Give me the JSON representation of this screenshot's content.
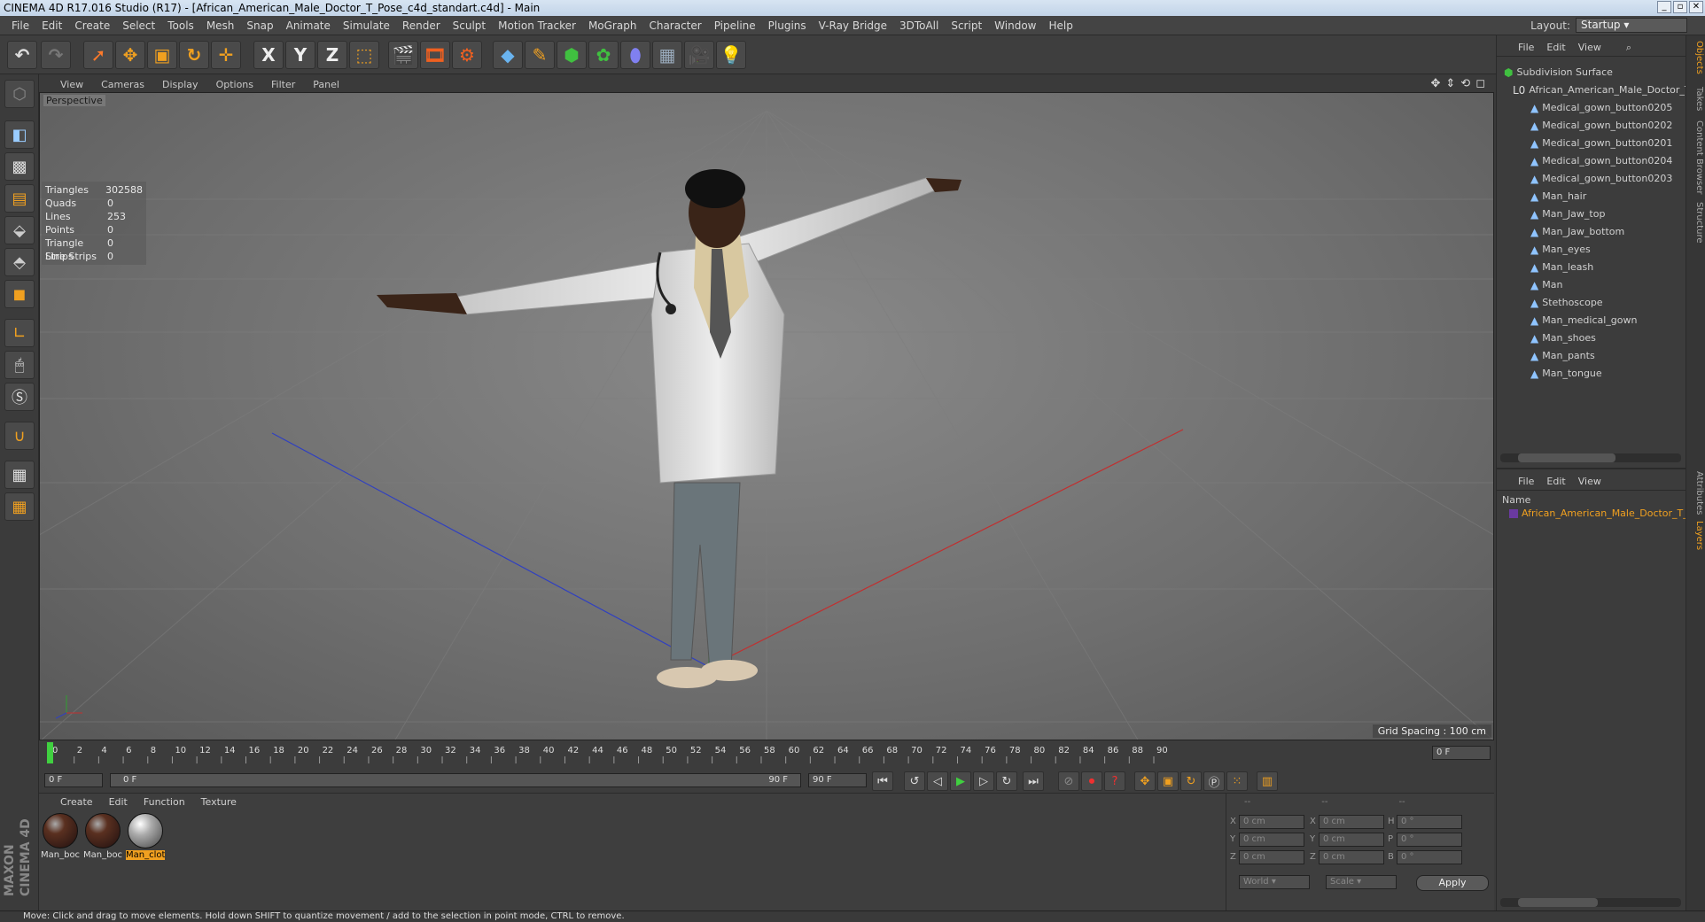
{
  "window": {
    "title": "CINEMA 4D R17.016 Studio (R17) - [African_American_Male_Doctor_T_Pose_c4d_standart.c4d] - Main"
  },
  "menu": [
    "File",
    "Edit",
    "Create",
    "Select",
    "Tools",
    "Mesh",
    "Snap",
    "Animate",
    "Simulate",
    "Render",
    "Sculpt",
    "Motion Tracker",
    "MoGraph",
    "Character",
    "Pipeline",
    "Plugins",
    "V-Ray Bridge",
    "3DToAll",
    "Script",
    "Window",
    "Help"
  ],
  "layout": {
    "label": "Layout:",
    "value": "Startup"
  },
  "toolbar_axes": [
    "X",
    "Y",
    "Z"
  ],
  "viewport": {
    "menu": [
      "View",
      "Cameras",
      "Display",
      "Options",
      "Filter",
      "Panel"
    ],
    "camera": "Perspective",
    "grid_spacing": "Grid Spacing : 100 cm",
    "stats": [
      {
        "label": "Triangles",
        "value": "302588"
      },
      {
        "label": "Quads",
        "value": "0"
      },
      {
        "label": "Lines",
        "value": "253"
      },
      {
        "label": "Points",
        "value": "0"
      },
      {
        "label": "Triangle Strips",
        "value": "0"
      },
      {
        "label": "Line Strips",
        "value": "0"
      }
    ]
  },
  "timeline": {
    "ticks": [
      "0",
      "2",
      "4",
      "6",
      "8",
      "10",
      "12",
      "14",
      "16",
      "18",
      "20",
      "22",
      "24",
      "26",
      "28",
      "30",
      "32",
      "34",
      "36",
      "38",
      "40",
      "42",
      "44",
      "46",
      "48",
      "50",
      "52",
      "54",
      "56",
      "58",
      "60",
      "62",
      "64",
      "66",
      "68",
      "70",
      "72",
      "74",
      "76",
      "78",
      "80",
      "82",
      "84",
      "86",
      "88",
      "90"
    ],
    "current_frame": "0 F",
    "start": "0 F",
    "range_start": "0 F",
    "range_end": "90 F",
    "end": "90 F"
  },
  "materials": {
    "menu": [
      "Create",
      "Edit",
      "Function",
      "Texture"
    ],
    "items": [
      "Man_boc",
      "Man_boc",
      "Man_clot"
    ]
  },
  "coords": {
    "headers": [
      "--",
      "--",
      "--"
    ],
    "rows": [
      {
        "a": "X",
        "av": "0 cm",
        "b": "X",
        "bv": "0 cm",
        "c": "H",
        "cv": "0 °"
      },
      {
        "a": "Y",
        "av": "0 cm",
        "b": "Y",
        "bv": "0 cm",
        "c": "P",
        "cv": "0 °"
      },
      {
        "a": "Z",
        "av": "0 cm",
        "b": "Z",
        "bv": "0 cm",
        "c": "B",
        "cv": "0 °"
      }
    ],
    "mode1": "World",
    "mode2": "Scale",
    "apply": "Apply"
  },
  "objects": {
    "menu": [
      "File",
      "Edit",
      "View"
    ],
    "root": "Subdivision Surface",
    "group": "African_American_Male_Doctor_T_",
    "children": [
      "Medical_gown_button0205",
      "Medical_gown_button0202",
      "Medical_gown_button0201",
      "Medical_gown_button0204",
      "Medical_gown_button0203",
      "Man_hair",
      "Man_Jaw_top",
      "Man_Jaw_bottom",
      "Man_eyes",
      "Man_leash",
      "Man",
      "Stethoscope",
      "Man_medical_gown",
      "Man_shoes",
      "Man_pants",
      "Man_tongue"
    ]
  },
  "layers": {
    "menu": [
      "File",
      "Edit",
      "View"
    ],
    "name_header": "Name",
    "item": "African_American_Male_Doctor_T_P"
  },
  "side_tabs": [
    "Objects",
    "Takes",
    "Content Browser",
    "Structure",
    "Attributes",
    "Layers"
  ],
  "status": "Move: Click and drag to move elements. Hold down SHIFT to quantize movement / add to the selection in point mode, CTRL to remove.",
  "maxon": "MAXON CINEMA 4D",
  "colors": {
    "accent": "#f0a020",
    "selection": "#ffb000",
    "x_axis": "#c03030",
    "z_axis": "#3030c0",
    "y_axis": "#30a030"
  }
}
